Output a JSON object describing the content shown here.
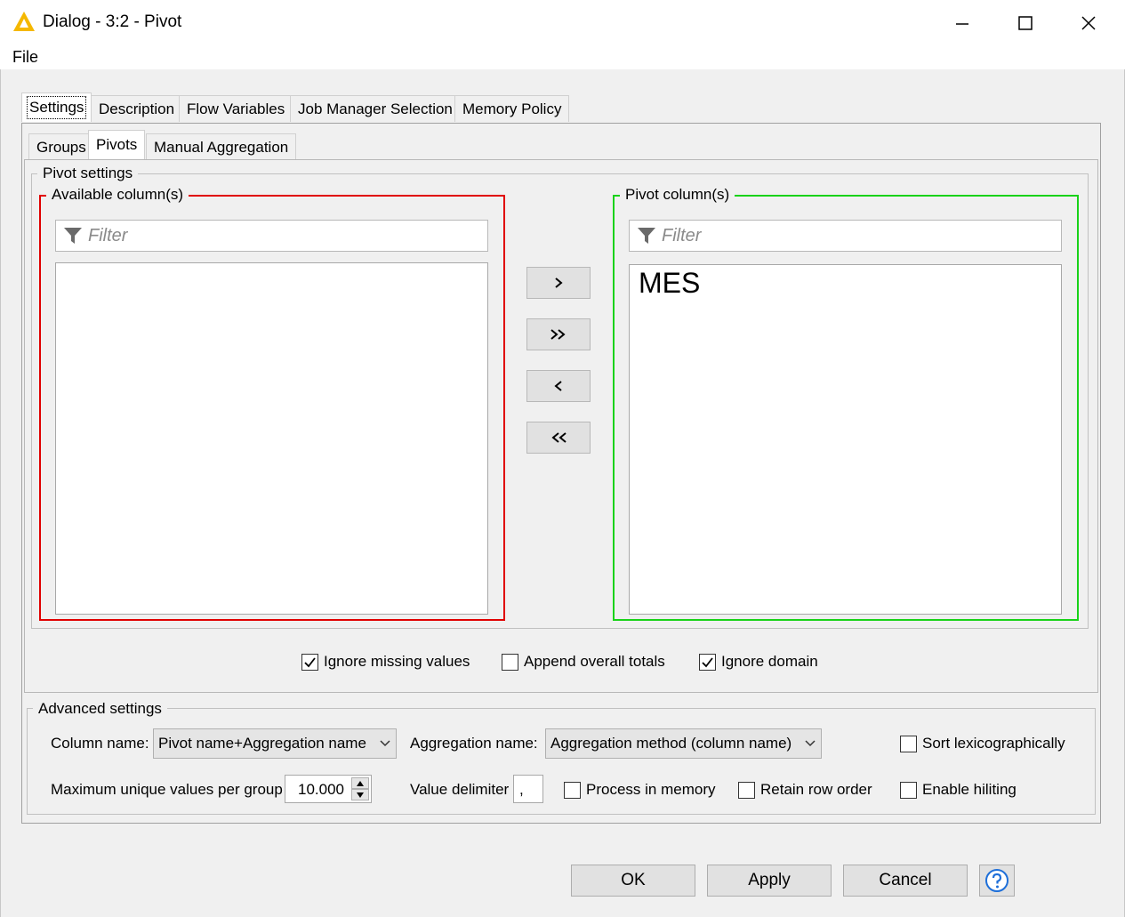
{
  "window": {
    "title": "Dialog - 3:2 - Pivot"
  },
  "menu": {
    "file": "File"
  },
  "tabs": [
    {
      "label": "Settings"
    },
    {
      "label": "Description"
    },
    {
      "label": "Flow Variables"
    },
    {
      "label": "Job Manager Selection"
    },
    {
      "label": "Memory Policy"
    }
  ],
  "subtabs": [
    {
      "label": "Groups"
    },
    {
      "label": "Pivots"
    },
    {
      "label": "Manual Aggregation"
    }
  ],
  "pivot_settings": {
    "title": "Pivot settings",
    "available": {
      "title": "Available column(s)",
      "filter_placeholder": "Filter",
      "items": []
    },
    "pivot": {
      "title": "Pivot column(s)",
      "filter_placeholder": "Filter",
      "items": [
        "MES"
      ]
    },
    "buttons": {
      "add": "›",
      "add_all": "»",
      "remove": "‹",
      "remove_all": "«"
    },
    "options": {
      "ignore_missing": {
        "label": "Ignore missing values",
        "checked": true
      },
      "append_totals": {
        "label": "Append overall totals",
        "checked": false
      },
      "ignore_domain": {
        "label": "Ignore domain",
        "checked": true
      }
    }
  },
  "advanced": {
    "title": "Advanced settings",
    "column_name_label": "Column name:",
    "column_name_value": "Pivot name+Aggregation name",
    "aggregation_name_label": "Aggregation name:",
    "aggregation_name_value": "Aggregation method (column name)",
    "sort_lex": {
      "label": "Sort lexicographically",
      "checked": false
    },
    "max_unique_label": "Maximum unique values per group",
    "max_unique_value": "10.000",
    "value_delimiter_label": "Value delimiter",
    "value_delimiter_value": ",",
    "process_in_memory": {
      "label": "Process in memory",
      "checked": false
    },
    "retain_row_order": {
      "label": "Retain row order",
      "checked": false
    },
    "enable_hiliting": {
      "label": "Enable hiliting",
      "checked": false
    }
  },
  "footer": {
    "ok": "OK",
    "apply": "Apply",
    "cancel": "Cancel",
    "help_icon": "help-icon"
  },
  "colors": {
    "available_border": "#e00000",
    "pivot_border": "#19d219",
    "help_blue": "#1e6fd9"
  }
}
